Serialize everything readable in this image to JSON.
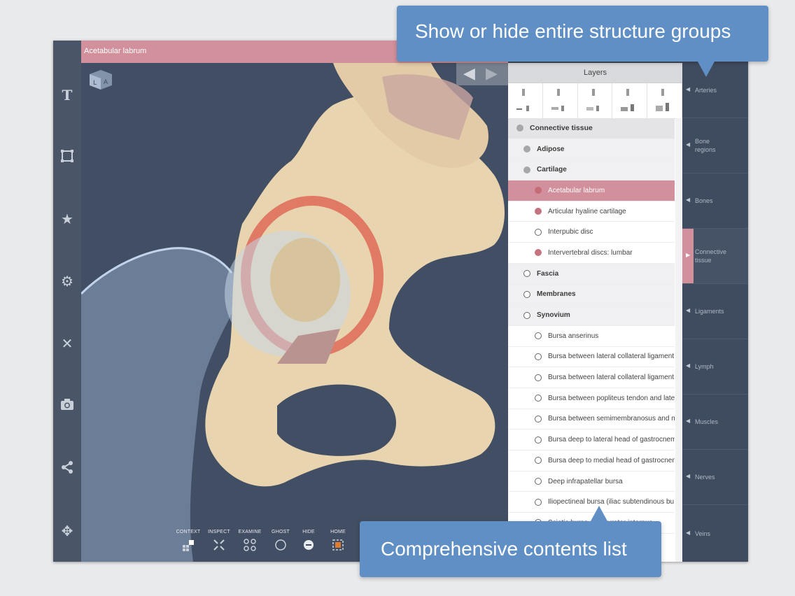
{
  "header": {
    "title": "Acetabular labrum"
  },
  "sidebar": {
    "icons": [
      "text-icon",
      "crop-icon",
      "star-icon",
      "gear-icon",
      "tools-icon",
      "camera-icon",
      "share-icon",
      "move-icon"
    ]
  },
  "toolbar": {
    "items": [
      {
        "label": "CONTEXT",
        "icon": "context-icon"
      },
      {
        "label": "INSPECT",
        "icon": "inspect-icon"
      },
      {
        "label": "EXAMINE",
        "icon": "examine-icon"
      },
      {
        "label": "GHOST",
        "icon": "ghost-icon"
      },
      {
        "label": "HIDE",
        "icon": "hide-icon"
      },
      {
        "label": "HOME",
        "icon": "home-icon"
      }
    ]
  },
  "layers": {
    "title": "Layers",
    "rows": [
      {
        "label": "Connective tissue",
        "level": 0,
        "dot": "grey"
      },
      {
        "label": "Adipose",
        "level": 1,
        "dot": "grey"
      },
      {
        "label": "Cartilage",
        "level": 1,
        "dot": "grey"
      },
      {
        "label": "Acetabular labrum",
        "level": 2,
        "dot": "selpink",
        "selected": true
      },
      {
        "label": "Articular hyaline cartilage",
        "level": 2,
        "dot": "pink"
      },
      {
        "label": "Interpubic disc",
        "level": 2,
        "dot": "empty"
      },
      {
        "label": "Intervertebral discs: lumbar",
        "level": 2,
        "dot": "pink"
      },
      {
        "label": "Fascia",
        "level": 1,
        "dot": "empty"
      },
      {
        "label": "Membranes",
        "level": 1,
        "dot": "empty"
      },
      {
        "label": "Synovium",
        "level": 1,
        "dot": "empty"
      },
      {
        "label": "Bursa anserinus",
        "level": 2,
        "dot": "empty"
      },
      {
        "label": "Bursa between lateral collateral ligament",
        "level": 2,
        "dot": "empty"
      },
      {
        "label": "Bursa between lateral collateral ligament",
        "level": 2,
        "dot": "empty"
      },
      {
        "label": "Bursa between popliteus tendon and late",
        "level": 2,
        "dot": "empty"
      },
      {
        "label": "Bursa between semimembranosus and m",
        "level": 2,
        "dot": "empty"
      },
      {
        "label": "Bursa deep to lateral head of gastrocnem",
        "level": 2,
        "dot": "empty"
      },
      {
        "label": "Bursa deep to medial head of gastrocnem",
        "level": 2,
        "dot": "empty"
      },
      {
        "label": "Deep infrapatellar bursa",
        "level": 2,
        "dot": "empty"
      },
      {
        "label": "Iliopectineal bursa (iliac subtendinous bu",
        "level": 2,
        "dot": "empty"
      },
      {
        "label": "Sciatic bursa of obturator internus",
        "level": 2,
        "dot": "empty"
      }
    ]
  },
  "groups": [
    {
      "label": "Arteries"
    },
    {
      "label": "Bone regions"
    },
    {
      "label": "Bones"
    },
    {
      "label": "Connective tissue",
      "active": true
    },
    {
      "label": "Ligaments"
    },
    {
      "label": "Lymph"
    },
    {
      "label": "Muscles"
    },
    {
      "label": "Nerves"
    },
    {
      "label": "Veins"
    }
  ],
  "callouts": {
    "top": "Show or hide entire structure groups",
    "bottom": "Comprehensive contents list"
  },
  "colors": {
    "accent": "#d1909b",
    "panel": "#3f4b5f",
    "callout": "#5f8fc4",
    "bone": "#ead6b4"
  }
}
